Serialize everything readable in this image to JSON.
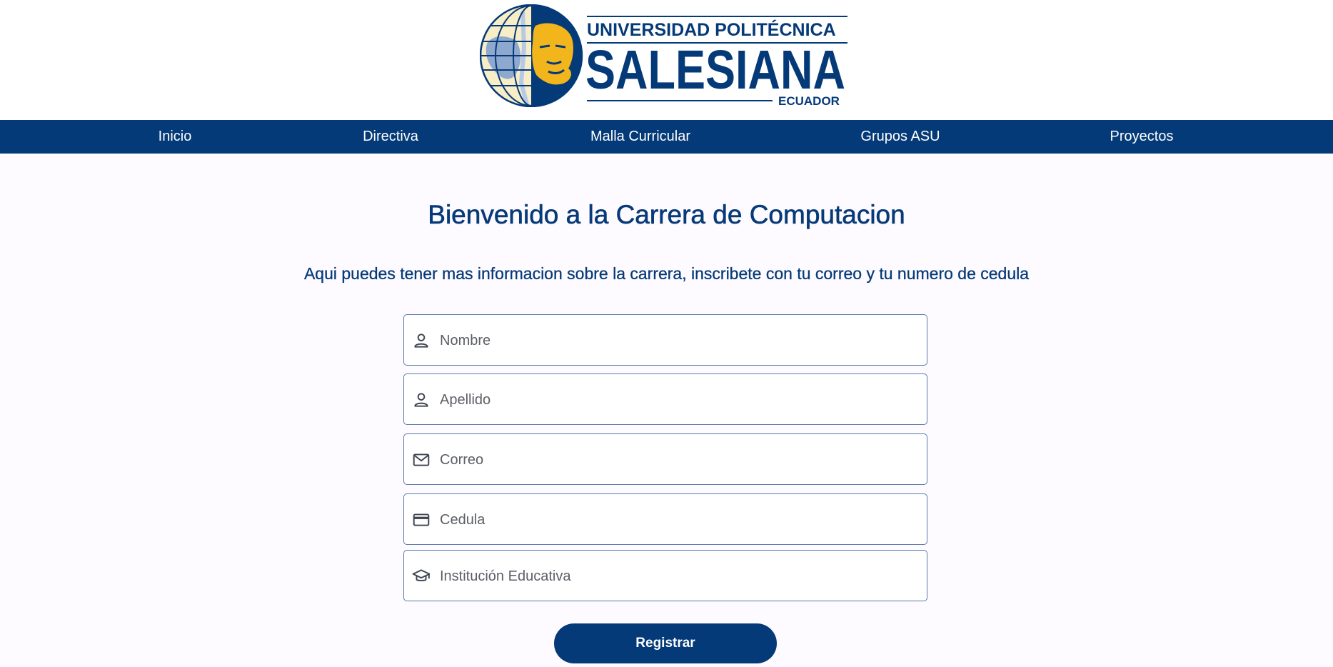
{
  "brand": {
    "line1": "UNIVERSIDAD POLITÉCNICA",
    "line2": "SALESIANA",
    "line3": "ECUADOR",
    "colors": {
      "navy": "#053a78",
      "gold": "#f2b51c",
      "cream": "#f7edc6",
      "light_blue": "#b6c9e6"
    }
  },
  "nav": {
    "items": [
      {
        "label": "Inicio"
      },
      {
        "label": "Directiva"
      },
      {
        "label": "Malla Curricular"
      },
      {
        "label": "Grupos ASU"
      },
      {
        "label": "Proyectos"
      }
    ]
  },
  "main": {
    "title": "Bienvenido a la Carrera de Computacion",
    "subtitle": "Aqui puedes tener mas informacion sobre la carrera, inscribete con tu correo y tu numero de cedula"
  },
  "form": {
    "fields": [
      {
        "placeholder": "Nombre",
        "icon": "person-icon"
      },
      {
        "placeholder": "Apellido",
        "icon": "person-icon"
      },
      {
        "placeholder": "Correo",
        "icon": "mail-icon"
      },
      {
        "placeholder": "Cedula",
        "icon": "credit-card-icon"
      },
      {
        "placeholder": "Institución Educativa",
        "icon": "graduation-cap-icon"
      }
    ],
    "submit_label": "Registrar"
  }
}
